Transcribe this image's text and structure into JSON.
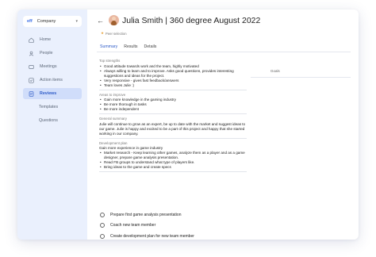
{
  "sidebar": {
    "company": {
      "logo": "eff",
      "name": "Company"
    },
    "items": [
      {
        "label": "Home",
        "icon": "home-icon"
      },
      {
        "label": "People",
        "icon": "people-icon"
      },
      {
        "label": "Meetings",
        "icon": "meetings-icon"
      },
      {
        "label": "Action items",
        "icon": "action-items-icon"
      },
      {
        "label": "Reviews",
        "icon": "reviews-icon",
        "active": true
      }
    ],
    "subitems": [
      "Templates",
      "Questions"
    ]
  },
  "header": {
    "title": "Julia Smith | 360 degree August 2022",
    "badge": "Peer selection"
  },
  "tabs": [
    "Summary",
    "Results",
    "Details"
  ],
  "sections": [
    {
      "title": "Top strengths",
      "bullets": [
        "Good attitude towards work and the team, highly motivated",
        "Always willing to learn and to improve. Asks good questions, provides interesting suggestions and ideas for the project.",
        "Very responsive - gives fast feedback/answers",
        "Team loves Julie :)"
      ]
    },
    {
      "title": "Areas to improve",
      "bullets": [
        "Gain more knowledge in the gaming industry",
        "Be more thorough in tasks",
        "Be more independent"
      ]
    },
    {
      "title": "General summary",
      "text": "Julie will continue to grow as an expert, be up to date with the market and suggest ideas to our game. Julie is happy and excited to be a part of this project and happy that she started working in our company."
    },
    {
      "title": "Development plan",
      "intro": "Gain more experience in game industry",
      "bullets": [
        "Market research - Keep learning other games, analyze them as a player and as a game designer, prepare game analysis presentation.",
        "Read FB groups to understand what type of players like.",
        "Bring ideas to the game and create specs"
      ]
    }
  ],
  "goals_label": "Goals",
  "tasks": [
    "Prepare first game analysis presentation",
    "Coach new team member",
    "Create development plan for new team member"
  ]
}
